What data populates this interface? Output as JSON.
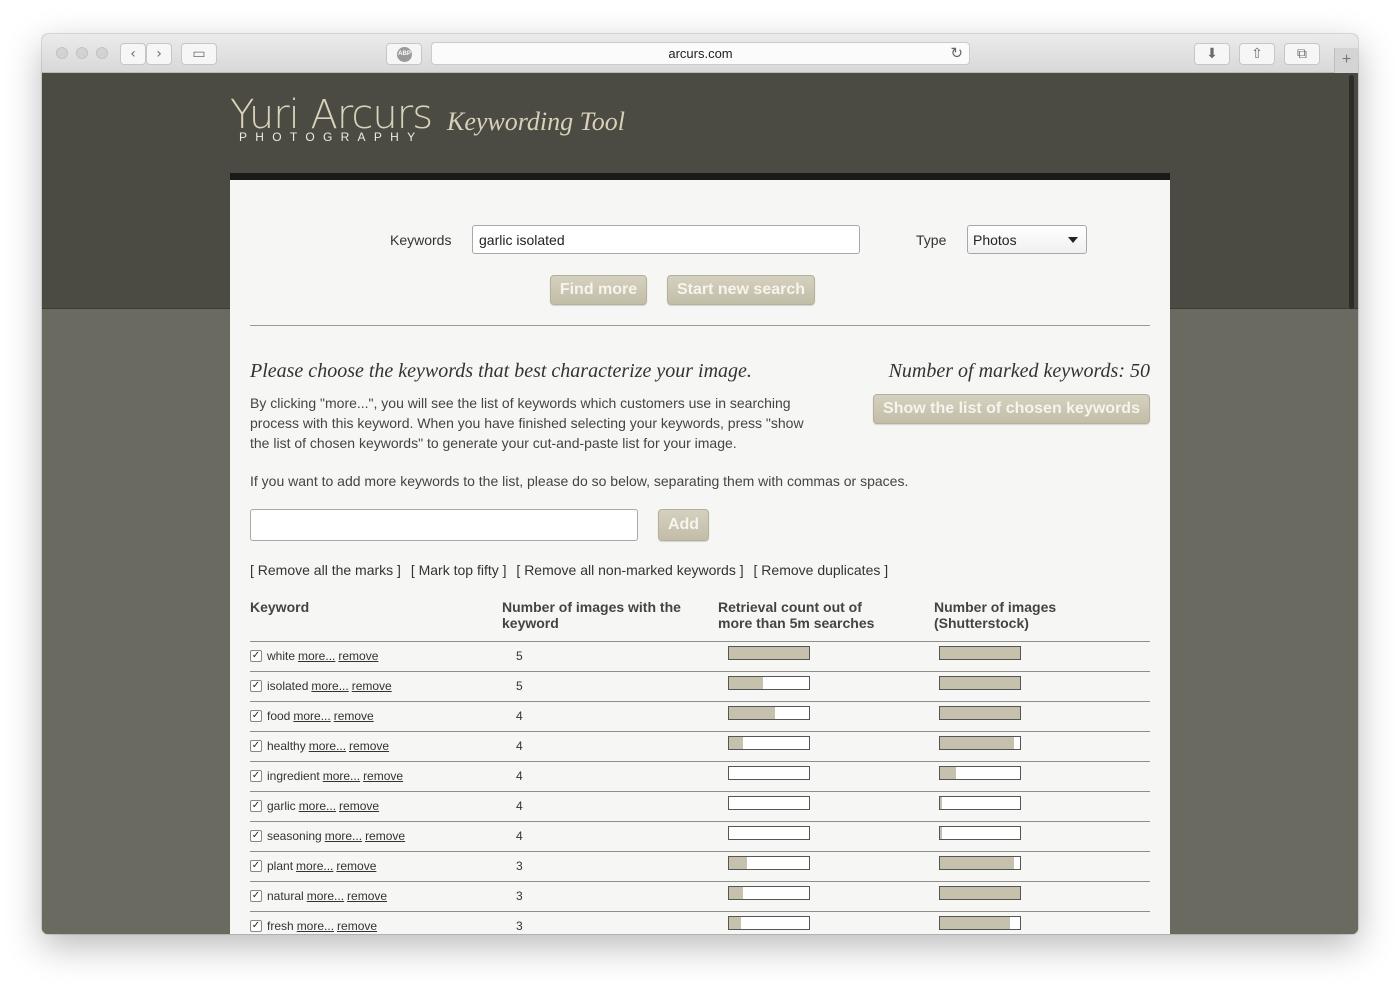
{
  "browser": {
    "url": "arcurs.com",
    "reload_glyph": "↻",
    "newtab_glyph": "+",
    "abp_label": "ABP",
    "back_glyph": "‹",
    "forward_glyph": "›",
    "sidebar_glyph": "▭",
    "download_glyph": "⬇",
    "share_glyph": "⇧",
    "tabs_glyph": "⧉"
  },
  "header": {
    "logo_name": "Yuri Arcurs",
    "logo_sub": "PHOTOGRAPHY",
    "tool_title": "Keywording Tool"
  },
  "search": {
    "keywords_label": "Keywords",
    "keywords_value": "garlic isolated",
    "type_label": "Type",
    "type_value": "Photos",
    "find_more_label": "Find more",
    "new_search_label": "Start new search"
  },
  "intro": {
    "heading": "Please choose the keywords that best characterize your image.",
    "marked_label": "Number of marked keywords: 50",
    "show_list_label": "Show the list of chosen keywords",
    "paragraph": "By clicking \"more...\", you will see the list of keywords which customers use in searching process with this keyword. When you have finished selecting your keywords, press \"show the list of chosen keywords\" to generate your cut-and-paste list for your image.",
    "add_paragraph": "If you want to add more keywords to the list, please do so below, separating them with commas or spaces.",
    "add_label": "Add"
  },
  "actions": [
    "[ Remove all the marks ]",
    "[ Mark top fifty ]",
    "[ Remove all non-marked keywords ]",
    "[ Remove duplicates ]"
  ],
  "table": {
    "headers": {
      "keyword": "Keyword",
      "images": "Number of images with the keyword",
      "retrieval": "Retrieval count out of more than 5m searches",
      "shutterstock": "Number of images (Shutterstock)"
    },
    "more_label": "more...",
    "remove_label": "remove",
    "check_glyph": "✓",
    "rows": [
      {
        "keyword": "white",
        "count": "5",
        "retrieval": 1.0,
        "shutterstock": 1.0
      },
      {
        "keyword": "isolated",
        "count": "5",
        "retrieval": 0.42,
        "shutterstock": 1.0
      },
      {
        "keyword": "food",
        "count": "4",
        "retrieval": 0.58,
        "shutterstock": 1.0
      },
      {
        "keyword": "healthy",
        "count": "4",
        "retrieval": 0.18,
        "shutterstock": 0.93
      },
      {
        "keyword": "ingredient",
        "count": "4",
        "retrieval": 0.0,
        "shutterstock": 0.2
      },
      {
        "keyword": "garlic",
        "count": "4",
        "retrieval": 0.0,
        "shutterstock": 0.03
      },
      {
        "keyword": "seasoning",
        "count": "4",
        "retrieval": 0.0,
        "shutterstock": 0.02
      },
      {
        "keyword": "plant",
        "count": "3",
        "retrieval": 0.23,
        "shutterstock": 0.93
      },
      {
        "keyword": "natural",
        "count": "3",
        "retrieval": 0.18,
        "shutterstock": 1.0
      },
      {
        "keyword": "fresh",
        "count": "3",
        "retrieval": 0.15,
        "shutterstock": 0.88
      }
    ]
  }
}
